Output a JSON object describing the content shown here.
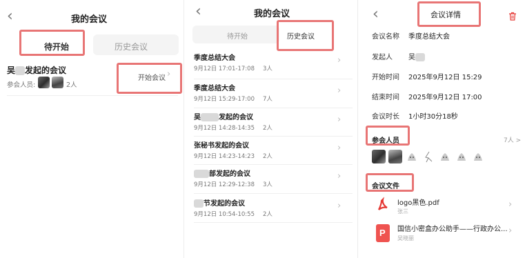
{
  "panel1": {
    "title": "我的会议",
    "tabs": [
      "待开始",
      "历史会议"
    ],
    "meeting": {
      "title_prefix": "吴",
      "title_suffix": "发起的会议",
      "attendees_label": "参会人员:",
      "attendee_count": "2人",
      "start_button": "开始会议"
    }
  },
  "panel2": {
    "title": "我的会议",
    "tabs": [
      "待开始",
      "历史会议"
    ],
    "meetings": [
      {
        "title": "季度总结大会",
        "time": "9月12日 17:01-17:08",
        "count": "3人"
      },
      {
        "title": "季度总结大会",
        "time": "9月12日 15:29-17:00",
        "count": "7人"
      },
      {
        "title_prefix": "吴",
        "title": "发起的会议",
        "time": "9月12日 14:28-14:35",
        "count": "2人"
      },
      {
        "title": "张秘书发起的会议",
        "time": "9月12日 14:23-14:23",
        "count": "2人"
      },
      {
        "title_prefix": "",
        "title": "部发起的会议",
        "time": "9月12日 12:29-12:38",
        "count": "3人"
      },
      {
        "title_prefix": "",
        "title": "节发起的会议",
        "time": "9月12日 10:54-10:55",
        "count": "2人"
      }
    ]
  },
  "panel3": {
    "title": "会议详情",
    "details": [
      {
        "label": "会议名称",
        "value": "季度总结大会"
      },
      {
        "label": "发起人",
        "value": "吴"
      },
      {
        "label": "开始时间",
        "value": "2025年9月12日 15:29"
      },
      {
        "label": "结束时间",
        "value": "2025年9月12日 17:00"
      },
      {
        "label": "会议时长",
        "value": "1小时30分18秒"
      }
    ],
    "attendees_title": "参会人员",
    "attendees_count": "7人 >",
    "files_title": "会议文件",
    "files": [
      {
        "name": "logo黑色.pdf",
        "owner": "张三",
        "icon": "pdf-icon",
        "color": "#e53935"
      },
      {
        "name": "国信小密盒办公助手——行政办公...",
        "owner": "吴晓丽",
        "icon": "ppt-icon",
        "color": "#ef5350"
      }
    ]
  },
  "colors": {
    "highlight": "#e87575",
    "delete_icon": "#e53935"
  }
}
